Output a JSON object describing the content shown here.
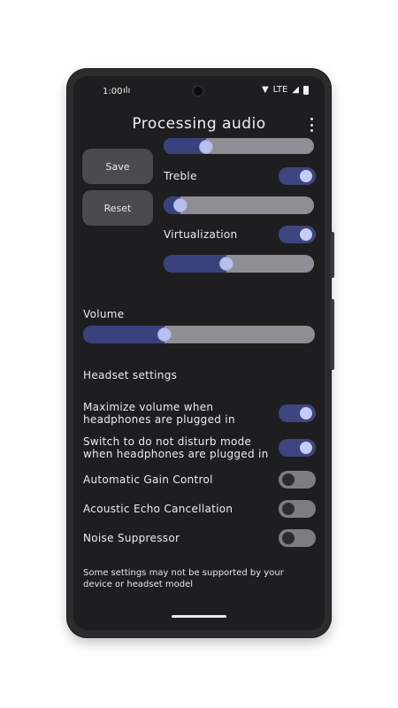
{
  "status_bar": {
    "time": "1:00",
    "network": "LTE"
  },
  "header": {
    "title": "Processing audio"
  },
  "actions": {
    "save_label": "Save",
    "reset_label": "Reset"
  },
  "effects": {
    "top_slider_level": 0.28,
    "treble": {
      "label": "Treble",
      "enabled": true,
      "level": 0.11
    },
    "virtualization": {
      "label": "Virtualization",
      "enabled": true,
      "level": 0.42
    }
  },
  "volume": {
    "label": "Volume",
    "level": 0.35
  },
  "headset": {
    "heading": "Headset settings",
    "items": [
      {
        "label": "Maximize volume when headphones are plugged in",
        "enabled": true
      },
      {
        "label": "Switch to do not disturb mode when headphones are plugged in",
        "enabled": true
      },
      {
        "label": "Automatic Gain Control",
        "enabled": false
      },
      {
        "label": "Acoustic Echo Cancellation",
        "enabled": false
      },
      {
        "label": "Noise Suppressor",
        "enabled": false
      }
    ]
  },
  "footer_note": "Some settings may not be supported by your device or headset model",
  "colors": {
    "accent_track": "#39427c",
    "switch_on": "#3d4680",
    "knob_on": "#c5ccf5",
    "switch_off": "#7c7c82",
    "background": "#1e1e20"
  }
}
